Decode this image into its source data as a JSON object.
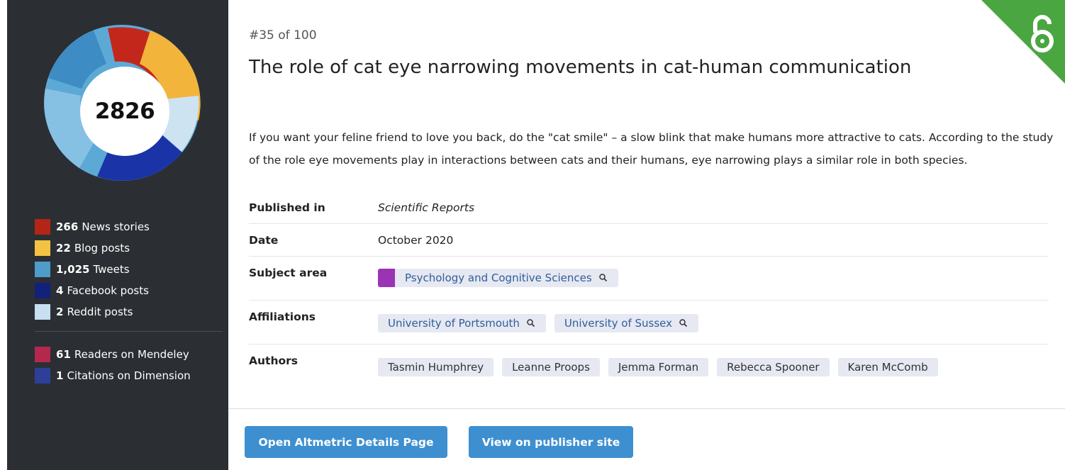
{
  "attention": {
    "score": "2826",
    "sources": [
      {
        "count": "266",
        "label": "News stories",
        "color": "#b42417"
      },
      {
        "count": "22",
        "label": "Blog posts",
        "color": "#f4c243"
      },
      {
        "count": "1,025",
        "label": "Tweets",
        "color": "#4f9bc9"
      },
      {
        "count": "4",
        "label": "Facebook posts",
        "color": "#12217a"
      },
      {
        "count": "2",
        "label": "Reddit posts",
        "color": "#c7dff0"
      }
    ],
    "readers": [
      {
        "count": "61",
        "label": "Readers on Mendeley",
        "color": "#b5284e"
      },
      {
        "count": "1",
        "label": "Citations on Dimension",
        "color": "#2e3f98"
      }
    ]
  },
  "article": {
    "rank": "#35 of 100",
    "title": "The role of cat eye narrowing movements in cat-human communication",
    "summary": "If you want your feline friend to love you back, do the \"cat smile\" – a slow blink that make humans more attractive to cats. According to the study of the role eye movements play in interactions between cats and their humans, eye narrowing plays a similar role in both species.",
    "open_access_icon": "open-access-lock-icon",
    "open_access_color": "#4aa640"
  },
  "meta": {
    "published_label": "Published in",
    "published_value": "Scientific Reports",
    "date_label": "Date",
    "date_value": "October 2020",
    "subject_label": "Subject area",
    "subject_value": "Psychology and Cognitive Sciences",
    "subject_color": "#9b33b5",
    "affiliations_label": "Affiliations",
    "affiliations": [
      "University of Portsmouth",
      "University of Sussex"
    ],
    "authors_label": "Authors",
    "authors": [
      "Tasmin Humphrey",
      "Leanne Proops",
      "Jemma Forman",
      "Rebecca Spooner",
      "Karen McComb"
    ]
  },
  "actions": {
    "details_label": "Open Altmetric Details Page",
    "publisher_label": "View on publisher site",
    "button_color": "#3d8fd0"
  }
}
